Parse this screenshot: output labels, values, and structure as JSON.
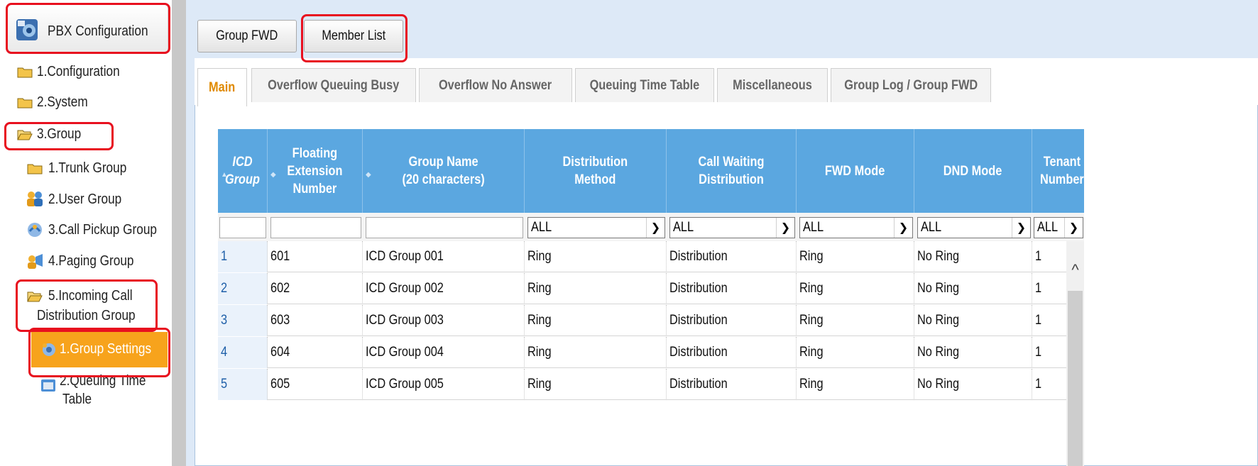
{
  "sidebar": {
    "header": "PBX Configuration",
    "items": [
      {
        "label": "1.Configuration"
      },
      {
        "label": "2.System"
      },
      {
        "label": "3.Group"
      },
      {
        "label": "1.Trunk Group"
      },
      {
        "label": "2.User Group"
      },
      {
        "label": "3.Call Pickup Group"
      },
      {
        "label": "4.Paging Group"
      },
      {
        "label": "5.Incoming Call"
      },
      {
        "label": "Distribution Group"
      },
      {
        "label": "1.Group Settings"
      },
      {
        "label": "2.Queuing Time"
      },
      {
        "label": "Table"
      }
    ]
  },
  "top_buttons": {
    "group_fwd": "Group FWD",
    "member_list": "Member List"
  },
  "tabs": [
    {
      "label": "Main"
    },
    {
      "label": "Overflow Queuing Busy"
    },
    {
      "label": "Overflow No Answer"
    },
    {
      "label": "Queuing Time Table"
    },
    {
      "label": "Miscellaneous"
    },
    {
      "label": "Group Log / Group FWD"
    }
  ],
  "table": {
    "columns": [
      {
        "label": "ICD\nGroup"
      },
      {
        "label": "Floating\nExtension\nNumber"
      },
      {
        "label": "Group Name\n(20 characters)"
      },
      {
        "label": "Distribution\nMethod"
      },
      {
        "label": "Call Waiting\nDistribution"
      },
      {
        "label": "FWD Mode"
      },
      {
        "label": "DND Mode"
      },
      {
        "label": "Tenant\nNumber"
      }
    ],
    "filters": [
      "ALL",
      "ALL",
      "ALL",
      "ALL",
      "ALL"
    ],
    "rows": [
      [
        "1",
        "601",
        "ICD Group 001",
        "Ring",
        "Distribution",
        "Ring",
        "No Ring",
        "1"
      ],
      [
        "2",
        "602",
        "ICD Group 002",
        "Ring",
        "Distribution",
        "Ring",
        "No Ring",
        "1"
      ],
      [
        "3",
        "603",
        "ICD Group 003",
        "Ring",
        "Distribution",
        "Ring",
        "No Ring",
        "1"
      ],
      [
        "4",
        "604",
        "ICD Group 004",
        "Ring",
        "Distribution",
        "Ring",
        "No Ring",
        "1"
      ],
      [
        "5",
        "605",
        "ICD Group 005",
        "Ring",
        "Distribution",
        "Ring",
        "No Ring",
        "1"
      ]
    ]
  },
  "colors": {
    "header_blue": "#5ba7e0",
    "active_item": "#f7a31c",
    "highlight_red": "#e8101f",
    "active_tab_text": "#e08a00"
  }
}
